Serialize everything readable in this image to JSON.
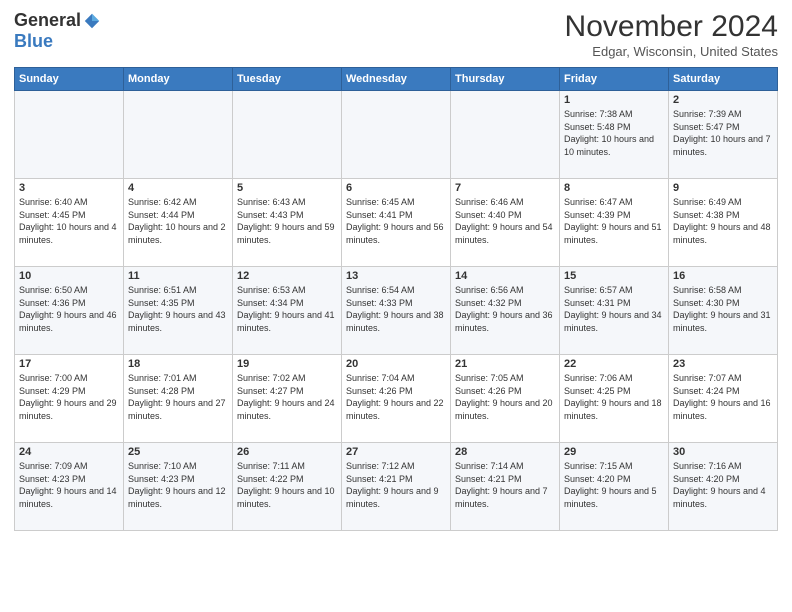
{
  "logo": {
    "general": "General",
    "blue": "Blue"
  },
  "title": "November 2024",
  "location": "Edgar, Wisconsin, United States",
  "headers": [
    "Sunday",
    "Monday",
    "Tuesday",
    "Wednesday",
    "Thursday",
    "Friday",
    "Saturday"
  ],
  "weeks": [
    [
      {
        "day": "",
        "info": ""
      },
      {
        "day": "",
        "info": ""
      },
      {
        "day": "",
        "info": ""
      },
      {
        "day": "",
        "info": ""
      },
      {
        "day": "",
        "info": ""
      },
      {
        "day": "1",
        "info": "Sunrise: 7:38 AM\nSunset: 5:48 PM\nDaylight: 10 hours and 10 minutes."
      },
      {
        "day": "2",
        "info": "Sunrise: 7:39 AM\nSunset: 5:47 PM\nDaylight: 10 hours and 7 minutes."
      }
    ],
    [
      {
        "day": "3",
        "info": "Sunrise: 6:40 AM\nSunset: 4:45 PM\nDaylight: 10 hours and 4 minutes."
      },
      {
        "day": "4",
        "info": "Sunrise: 6:42 AM\nSunset: 4:44 PM\nDaylight: 10 hours and 2 minutes."
      },
      {
        "day": "5",
        "info": "Sunrise: 6:43 AM\nSunset: 4:43 PM\nDaylight: 9 hours and 59 minutes."
      },
      {
        "day": "6",
        "info": "Sunrise: 6:45 AM\nSunset: 4:41 PM\nDaylight: 9 hours and 56 minutes."
      },
      {
        "day": "7",
        "info": "Sunrise: 6:46 AM\nSunset: 4:40 PM\nDaylight: 9 hours and 54 minutes."
      },
      {
        "day": "8",
        "info": "Sunrise: 6:47 AM\nSunset: 4:39 PM\nDaylight: 9 hours and 51 minutes."
      },
      {
        "day": "9",
        "info": "Sunrise: 6:49 AM\nSunset: 4:38 PM\nDaylight: 9 hours and 48 minutes."
      }
    ],
    [
      {
        "day": "10",
        "info": "Sunrise: 6:50 AM\nSunset: 4:36 PM\nDaylight: 9 hours and 46 minutes."
      },
      {
        "day": "11",
        "info": "Sunrise: 6:51 AM\nSunset: 4:35 PM\nDaylight: 9 hours and 43 minutes."
      },
      {
        "day": "12",
        "info": "Sunrise: 6:53 AM\nSunset: 4:34 PM\nDaylight: 9 hours and 41 minutes."
      },
      {
        "day": "13",
        "info": "Sunrise: 6:54 AM\nSunset: 4:33 PM\nDaylight: 9 hours and 38 minutes."
      },
      {
        "day": "14",
        "info": "Sunrise: 6:56 AM\nSunset: 4:32 PM\nDaylight: 9 hours and 36 minutes."
      },
      {
        "day": "15",
        "info": "Sunrise: 6:57 AM\nSunset: 4:31 PM\nDaylight: 9 hours and 34 minutes."
      },
      {
        "day": "16",
        "info": "Sunrise: 6:58 AM\nSunset: 4:30 PM\nDaylight: 9 hours and 31 minutes."
      }
    ],
    [
      {
        "day": "17",
        "info": "Sunrise: 7:00 AM\nSunset: 4:29 PM\nDaylight: 9 hours and 29 minutes."
      },
      {
        "day": "18",
        "info": "Sunrise: 7:01 AM\nSunset: 4:28 PM\nDaylight: 9 hours and 27 minutes."
      },
      {
        "day": "19",
        "info": "Sunrise: 7:02 AM\nSunset: 4:27 PM\nDaylight: 9 hours and 24 minutes."
      },
      {
        "day": "20",
        "info": "Sunrise: 7:04 AM\nSunset: 4:26 PM\nDaylight: 9 hours and 22 minutes."
      },
      {
        "day": "21",
        "info": "Sunrise: 7:05 AM\nSunset: 4:26 PM\nDaylight: 9 hours and 20 minutes."
      },
      {
        "day": "22",
        "info": "Sunrise: 7:06 AM\nSunset: 4:25 PM\nDaylight: 9 hours and 18 minutes."
      },
      {
        "day": "23",
        "info": "Sunrise: 7:07 AM\nSunset: 4:24 PM\nDaylight: 9 hours and 16 minutes."
      }
    ],
    [
      {
        "day": "24",
        "info": "Sunrise: 7:09 AM\nSunset: 4:23 PM\nDaylight: 9 hours and 14 minutes."
      },
      {
        "day": "25",
        "info": "Sunrise: 7:10 AM\nSunset: 4:23 PM\nDaylight: 9 hours and 12 minutes."
      },
      {
        "day": "26",
        "info": "Sunrise: 7:11 AM\nSunset: 4:22 PM\nDaylight: 9 hours and 10 minutes."
      },
      {
        "day": "27",
        "info": "Sunrise: 7:12 AM\nSunset: 4:21 PM\nDaylight: 9 hours and 9 minutes."
      },
      {
        "day": "28",
        "info": "Sunrise: 7:14 AM\nSunset: 4:21 PM\nDaylight: 9 hours and 7 minutes."
      },
      {
        "day": "29",
        "info": "Sunrise: 7:15 AM\nSunset: 4:20 PM\nDaylight: 9 hours and 5 minutes."
      },
      {
        "day": "30",
        "info": "Sunrise: 7:16 AM\nSunset: 4:20 PM\nDaylight: 9 hours and 4 minutes."
      }
    ]
  ]
}
